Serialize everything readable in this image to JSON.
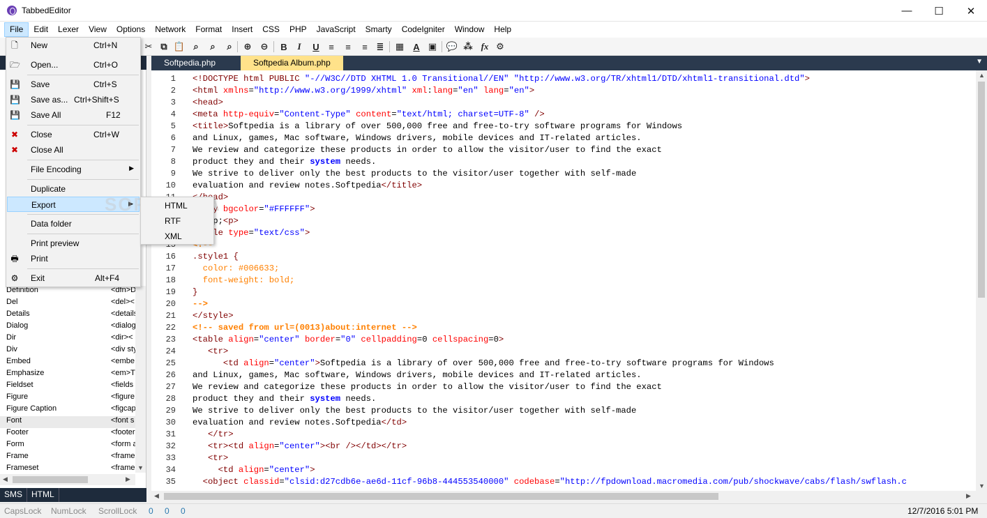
{
  "window": {
    "title": "TabbedEditor",
    "minimize": "—",
    "maximize": "☐",
    "close": "✕"
  },
  "menubar": [
    "File",
    "Edit",
    "Lexer",
    "View",
    "Options",
    "Network",
    "Format",
    "Insert",
    "CSS",
    "PHP",
    "JavaScript",
    "Smarty",
    "CodeIgniter",
    "Window",
    "Help"
  ],
  "file_menu": {
    "new": {
      "label": "New",
      "shortcut": "Ctrl+N"
    },
    "open": {
      "label": "Open...",
      "shortcut": "Ctrl+O"
    },
    "save": {
      "label": "Save",
      "shortcut": "Ctrl+S"
    },
    "save_as": {
      "label": "Save as...",
      "shortcut": "Ctrl+Shift+S"
    },
    "save_all": {
      "label": "Save All",
      "shortcut": "F12"
    },
    "close": {
      "label": "Close",
      "shortcut": "Ctrl+W"
    },
    "close_all": {
      "label": "Close All"
    },
    "file_encoding": {
      "label": "File Encoding"
    },
    "duplicate": {
      "label": "Duplicate"
    },
    "export": {
      "label": "Export"
    },
    "data_folder": {
      "label": "Data folder"
    },
    "print_preview": {
      "label": "Print preview"
    },
    "print": {
      "label": "Print"
    },
    "exit": {
      "label": "Exit",
      "shortcut": "Alt+F4"
    }
  },
  "export_submenu": [
    "HTML",
    "RTF",
    "XML"
  ],
  "watermark": "SOFTPEDIA",
  "tag_list": [
    {
      "name": "Definition",
      "value": "<dfn>D"
    },
    {
      "name": "Del",
      "value": "<del><"
    },
    {
      "name": "Details",
      "value": "<details"
    },
    {
      "name": "Dialog",
      "value": "<dialog"
    },
    {
      "name": "Dir",
      "value": "<dir><"
    },
    {
      "name": "Div",
      "value": "<div sty"
    },
    {
      "name": "Embed",
      "value": "<embe"
    },
    {
      "name": "Emphasize",
      "value": "<em>T"
    },
    {
      "name": "Fieldset",
      "value": "<fields"
    },
    {
      "name": "Figure",
      "value": "<figure"
    },
    {
      "name": "Figure Caption",
      "value": "<figcap"
    },
    {
      "name": "Font",
      "value": "<font s"
    },
    {
      "name": "Footer",
      "value": "<footer"
    },
    {
      "name": "Form",
      "value": "<form a"
    },
    {
      "name": "Frame",
      "value": "<frame"
    },
    {
      "name": "Frameset",
      "value": "<frame"
    }
  ],
  "left_tabs": [
    "SMS",
    "HTML"
  ],
  "editor_tabs": [
    {
      "label": "Softpedia.php",
      "active": false
    },
    {
      "label": "Softpedia Album.php",
      "active": true
    }
  ],
  "code_lines": [
    {
      "n": "1",
      "parts": [
        [
          "tag",
          "<!DOCTYPE html PUBLIC "
        ],
        [
          "val",
          "\"-//W3C//DTD XHTML 1.0 Transitional//EN\" \"http://www.w3.org/TR/xhtml1/DTD/xhtml1-transitional.dtd\""
        ],
        [
          "tag",
          ">"
        ]
      ]
    },
    {
      "n": "2",
      "parts": [
        [
          "tag",
          "<html "
        ],
        [
          "attr",
          "xmlns"
        ],
        [
          "txt",
          "="
        ],
        [
          "val",
          "\"http://www.w3.org/1999/xhtml\" "
        ],
        [
          "attr",
          "xml"
        ],
        [
          "txt",
          ":"
        ],
        [
          "attr",
          "lang"
        ],
        [
          "txt",
          "="
        ],
        [
          "val",
          "\"en\" "
        ],
        [
          "attr",
          "lang"
        ],
        [
          "txt",
          "="
        ],
        [
          "val",
          "\"en\""
        ],
        [
          "tag",
          ">"
        ]
      ]
    },
    {
      "n": "3",
      "parts": [
        [
          "tag",
          "<head>"
        ]
      ]
    },
    {
      "n": "4",
      "parts": [
        [
          "tag",
          "<meta "
        ],
        [
          "attr",
          "http-equiv"
        ],
        [
          "txt",
          "="
        ],
        [
          "val",
          "\"Content-Type\" "
        ],
        [
          "attr",
          "content"
        ],
        [
          "txt",
          "="
        ],
        [
          "val",
          "\"text/html; charset=UTF-8\" "
        ],
        [
          "tag",
          "/>"
        ]
      ]
    },
    {
      "n": "5",
      "parts": [
        [
          "tag",
          "<title>"
        ],
        [
          "txt",
          "Softpedia is a library of over 500,000 free and free-to-try software programs for Windows"
        ]
      ]
    },
    {
      "n": "6",
      "parts": [
        [
          "txt",
          "and Linux, games, Mac software, Windows drivers, mobile devices and IT-related articles."
        ]
      ]
    },
    {
      "n": "7",
      "parts": [
        [
          "txt",
          "We review and categorize these products in order to allow the visitor/user to find the exact"
        ]
      ]
    },
    {
      "n": "8",
      "parts": [
        [
          "txt",
          "product they and their "
        ],
        [
          "kw",
          "system"
        ],
        [
          "txt",
          " needs."
        ]
      ]
    },
    {
      "n": "9",
      "parts": [
        [
          "txt",
          "We strive to deliver only the best products to the visitor/user together with self-made"
        ]
      ]
    },
    {
      "n": "10",
      "parts": [
        [
          "txt",
          "evaluation and review notes.Softpedia"
        ],
        [
          "tag",
          "</title>"
        ]
      ]
    },
    {
      "n": "11",
      "parts": [
        [
          "tag",
          "</head>"
        ]
      ]
    },
    {
      "n": "12",
      "parts": [
        [
          "tag",
          "<body "
        ],
        [
          "attr",
          "bgcolor"
        ],
        [
          "txt",
          "="
        ],
        [
          "val",
          "\"#FFFFFF\""
        ],
        [
          "tag",
          ">"
        ]
      ]
    },
    {
      "n": "13",
      "parts": [
        [
          "txt",
          "&nbsp;"
        ],
        [
          "tag",
          "<p>"
        ]
      ]
    },
    {
      "n": "14",
      "parts": [
        [
          "tag",
          "<style "
        ],
        [
          "attr",
          "type"
        ],
        [
          "txt",
          "="
        ],
        [
          "val",
          "\"text/css\""
        ],
        [
          "tag",
          ">"
        ]
      ]
    },
    {
      "n": "15",
      "parts": [
        [
          "com",
          "<!--"
        ]
      ]
    },
    {
      "n": "16",
      "parts": [
        [
          "sel",
          ".style1 {"
        ]
      ]
    },
    {
      "n": "17",
      "parts": [
        [
          "css",
          "  color: #006633;"
        ]
      ]
    },
    {
      "n": "18",
      "parts": [
        [
          "css",
          "  font-weight: bold;"
        ]
      ]
    },
    {
      "n": "19",
      "parts": [
        [
          "sel",
          "}"
        ]
      ]
    },
    {
      "n": "20",
      "parts": [
        [
          "com",
          "-->"
        ]
      ]
    },
    {
      "n": "21",
      "parts": [
        [
          "tag",
          "</style>"
        ]
      ]
    },
    {
      "n": "22",
      "parts": [
        [
          "com",
          "<!-- saved from url=(0013)about:internet -->"
        ]
      ]
    },
    {
      "n": "23",
      "parts": [
        [
          "tag",
          "<table "
        ],
        [
          "attr",
          "align"
        ],
        [
          "txt",
          "="
        ],
        [
          "val",
          "\"center\" "
        ],
        [
          "attr",
          "border"
        ],
        [
          "txt",
          "="
        ],
        [
          "val",
          "\"0\" "
        ],
        [
          "attr",
          "cellpadding"
        ],
        [
          "txt",
          "=0 "
        ],
        [
          "attr",
          "cellspacing"
        ],
        [
          "txt",
          "=0"
        ],
        [
          "tag",
          ">"
        ]
      ]
    },
    {
      "n": "24",
      "parts": [
        [
          "tag",
          "   <tr>"
        ]
      ]
    },
    {
      "n": "25",
      "parts": [
        [
          "tag",
          "      <td "
        ],
        [
          "attr",
          "align"
        ],
        [
          "txt",
          "="
        ],
        [
          "val",
          "\"center\""
        ],
        [
          "tag",
          ">"
        ],
        [
          "txt",
          "Softpedia is a library of over 500,000 free and free-to-try software programs for Windows"
        ]
      ]
    },
    {
      "n": "26",
      "parts": [
        [
          "txt",
          "and Linux, games, Mac software, Windows drivers, mobile devices and IT-related articles."
        ]
      ]
    },
    {
      "n": "27",
      "parts": [
        [
          "txt",
          "We review and categorize these products in order to allow the visitor/user to find the exact"
        ]
      ]
    },
    {
      "n": "28",
      "parts": [
        [
          "txt",
          "product they and their "
        ],
        [
          "kw",
          "system"
        ],
        [
          "txt",
          " needs."
        ]
      ]
    },
    {
      "n": "29",
      "parts": [
        [
          "txt",
          "We strive to deliver only the best products to the visitor/user together with self-made"
        ]
      ]
    },
    {
      "n": "30",
      "parts": [
        [
          "txt",
          "evaluation and review notes.Softpedia"
        ],
        [
          "tag",
          "</td>"
        ]
      ]
    },
    {
      "n": "31",
      "parts": [
        [
          "tag",
          "   </tr>"
        ]
      ]
    },
    {
      "n": "32",
      "parts": [
        [
          "tag",
          "   <tr><td "
        ],
        [
          "attr",
          "align"
        ],
        [
          "txt",
          "="
        ],
        [
          "val",
          "\"center\""
        ],
        [
          "tag",
          "><br /></td></tr>"
        ]
      ]
    },
    {
      "n": "33",
      "parts": [
        [
          "tag",
          "   <tr>"
        ]
      ]
    },
    {
      "n": "34",
      "parts": [
        [
          "tag",
          "     <td "
        ],
        [
          "attr",
          "align"
        ],
        [
          "txt",
          "="
        ],
        [
          "val",
          "\"center\""
        ],
        [
          "tag",
          ">"
        ]
      ]
    },
    {
      "n": "35",
      "parts": [
        [
          "tag",
          "  <object "
        ],
        [
          "attr",
          "classid"
        ],
        [
          "txt",
          "="
        ],
        [
          "val",
          "\"clsid:d27cdb6e-ae6d-11cf-96b8-444553540000\" "
        ],
        [
          "attr",
          "codebase"
        ],
        [
          "txt",
          "="
        ],
        [
          "val",
          "\"http://fpdownload.macromedia.com/pub/shockwave/cabs/flash/swflash.c"
        ]
      ]
    }
  ],
  "statusbar": {
    "caps": "CapsLock",
    "num": "NumLock",
    "scroll": "ScrollLock",
    "v1": "0",
    "v2": "0",
    "v3": "0",
    "datetime": "12/7/2016 5:01 PM"
  },
  "toolbar_icons": [
    "cut-icon",
    "copy-icon",
    "paste-icon",
    "find-icon",
    "find-replace-icon",
    "zoom-in-icon",
    "zoom-out-icon",
    "bold-icon",
    "italic-icon",
    "underline-icon",
    "align-left-icon",
    "align-center-icon",
    "align-right-icon",
    "justify-icon",
    "table-icon",
    "font-icon",
    "image-icon",
    "comment-icon",
    "tags-icon",
    "function-icon",
    "magic-icon"
  ]
}
